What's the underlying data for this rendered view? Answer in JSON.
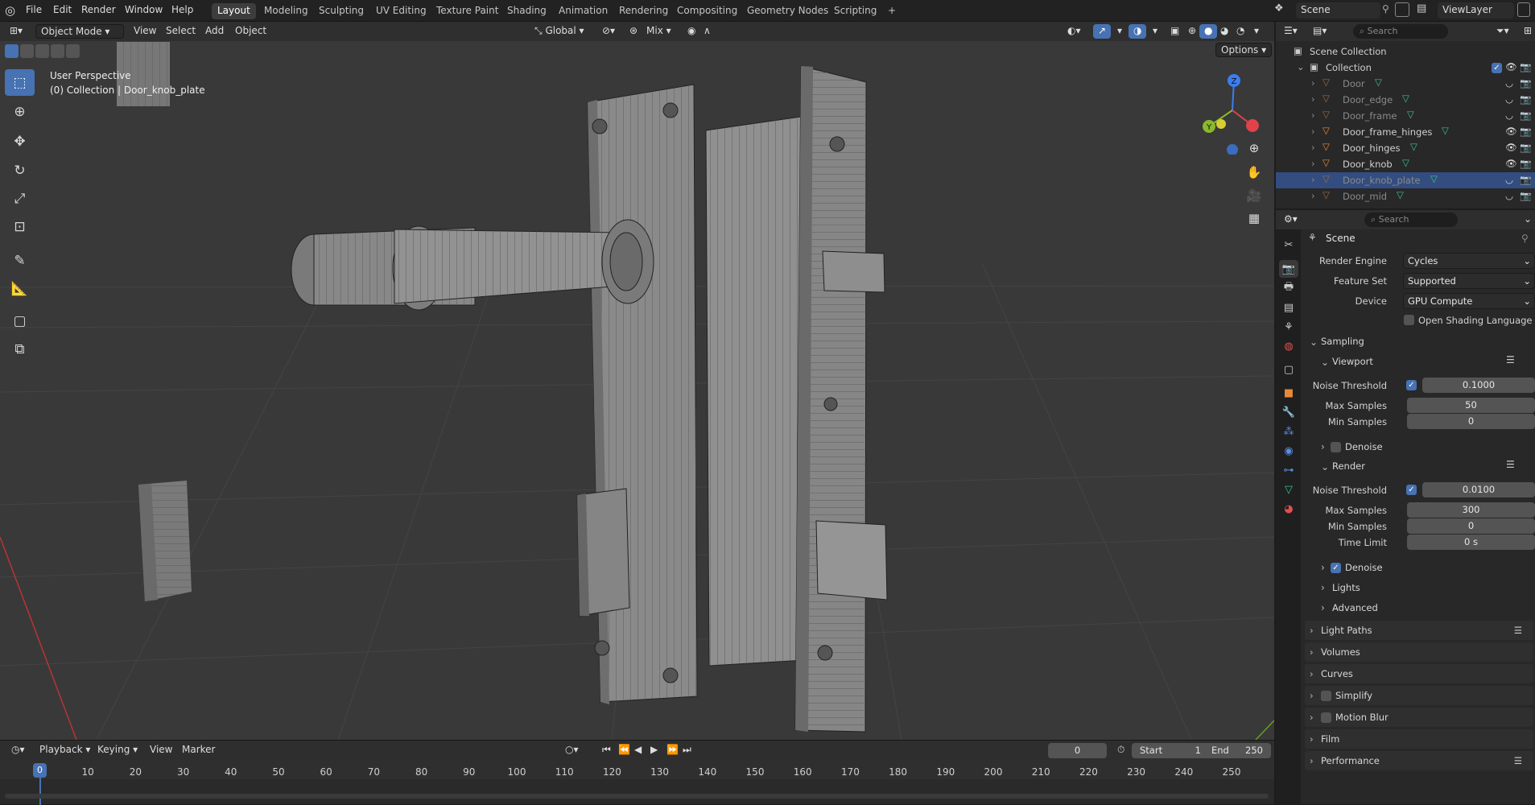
{
  "topbar": {
    "menus": [
      "File",
      "Edit",
      "Render",
      "Window",
      "Help"
    ],
    "workspaces": [
      "Layout",
      "Modeling",
      "Sculpting",
      "UV Editing",
      "Texture Paint",
      "Shading",
      "Animation",
      "Rendering",
      "Compositing",
      "Geometry Nodes",
      "Scripting"
    ],
    "add_tab": "+",
    "scene": "Scene",
    "view_layer": "ViewLayer"
  },
  "viewport": {
    "mode": "Object Mode",
    "menus": [
      "View",
      "Select",
      "Add",
      "Object"
    ],
    "transform_orientation": "Global",
    "snap_mode": "Mix",
    "options": "Options",
    "info_line1": "User Perspective",
    "info_line2": "(0) Collection | Door_knob_plate",
    "gizmo": {
      "z": "Z",
      "y": "Y",
      "x": "X"
    }
  },
  "tools": [
    "select-box",
    "cursor",
    "move",
    "rotate",
    "scale",
    "transform",
    "annotate",
    "measure",
    "add-cube",
    "extrude-cube"
  ],
  "timeline": {
    "menus": [
      "Playback",
      "Keying",
      "View",
      "Marker"
    ],
    "current_frame": "0",
    "start_label": "Start",
    "start": "1",
    "end_label": "End",
    "end": "250",
    "ruler": [
      "0",
      "10",
      "20",
      "30",
      "40",
      "50",
      "60",
      "70",
      "80",
      "90",
      "100",
      "110",
      "120",
      "130",
      "140",
      "150",
      "160",
      "170",
      "180",
      "190",
      "200",
      "210",
      "220",
      "230",
      "240",
      "250"
    ]
  },
  "outliner": {
    "search_placeholder": "Search",
    "scene_collection": "Scene Collection",
    "collection": "Collection",
    "items": [
      {
        "name": "Door",
        "visible": false,
        "selected": false
      },
      {
        "name": "Door_edge",
        "visible": false,
        "selected": false
      },
      {
        "name": "Door_frame",
        "visible": false,
        "selected": false
      },
      {
        "name": "Door_frame_hinges",
        "visible": true,
        "selected": false
      },
      {
        "name": "Door_hinges",
        "visible": true,
        "selected": false
      },
      {
        "name": "Door_knob",
        "visible": true,
        "selected": false
      },
      {
        "name": "Door_knob_plate",
        "visible": false,
        "selected": true
      },
      {
        "name": "Door_mid",
        "visible": false,
        "selected": false
      }
    ]
  },
  "properties": {
    "search_placeholder": "Search",
    "context": "Scene",
    "render_engine_label": "Render Engine",
    "render_engine": "Cycles",
    "feature_set_label": "Feature Set",
    "feature_set": "Supported",
    "device_label": "Device",
    "device": "GPU Compute",
    "osl_label": "Open Shading Language",
    "sampling": "Sampling",
    "viewport": "Viewport",
    "vp_noise_label": "Noise Threshold",
    "vp_noise": "0.1000",
    "vp_max_label": "Max Samples",
    "vp_max": "50",
    "vp_min_label": "Min Samples",
    "vp_min": "0",
    "vp_denoise": "Denoise",
    "render": "Render",
    "r_noise_label": "Noise Threshold",
    "r_noise": "0.0100",
    "r_max_label": "Max Samples",
    "r_max": "300",
    "r_min_label": "Min Samples",
    "r_min": "0",
    "r_time_label": "Time Limit",
    "r_time": "0 s",
    "r_denoise": "Denoise",
    "lights": "Lights",
    "advanced": "Advanced",
    "panels": [
      "Light Paths",
      "Volumes",
      "Curves",
      "Simplify",
      "Motion Blur",
      "Film",
      "Performance"
    ]
  },
  "colors": {
    "accent": "#4772b3",
    "selected_row": "#334d80",
    "object_orange": "#e8893a",
    "mesh_green": "#3fbf8f"
  }
}
